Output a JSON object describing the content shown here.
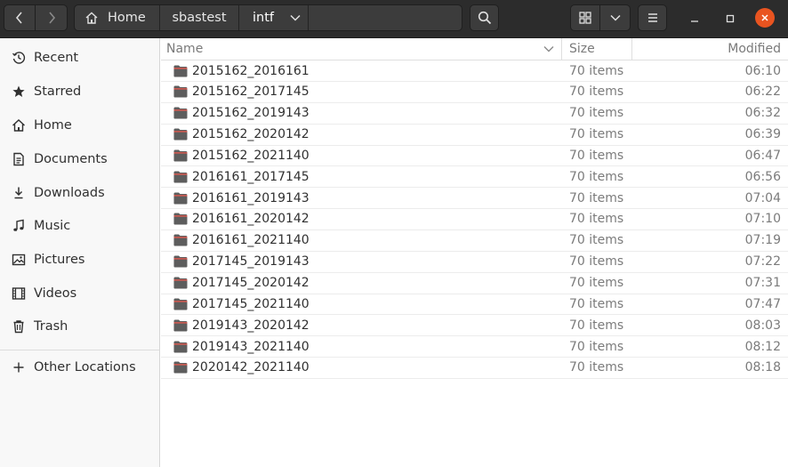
{
  "headerbar": {
    "path": [
      "Home",
      "sbastest",
      "intf"
    ],
    "icons": {
      "back": "chevron-left-icon",
      "forward": "chevron-right-icon",
      "home": "home-icon",
      "path_menu": "chevron-down-icon",
      "search": "search-icon",
      "view": "grid-view-icon",
      "view_menu": "chevron-down-icon",
      "main_menu": "hamburger-menu-icon",
      "minimize": "minimize-icon",
      "maximize": "maximize-icon",
      "close": "close-icon"
    }
  },
  "sidebar": {
    "items": [
      {
        "label": "Recent",
        "icon": "clock-icon"
      },
      {
        "label": "Starred",
        "icon": "star-icon"
      },
      {
        "label": "Home",
        "icon": "home-icon"
      },
      {
        "label": "Documents",
        "icon": "document-icon"
      },
      {
        "label": "Downloads",
        "icon": "download-icon"
      },
      {
        "label": "Music",
        "icon": "music-icon"
      },
      {
        "label": "Pictures",
        "icon": "picture-icon"
      },
      {
        "label": "Videos",
        "icon": "video-icon"
      },
      {
        "label": "Trash",
        "icon": "trash-icon"
      }
    ],
    "other_locations": {
      "label": "Other Locations",
      "icon": "plus-icon"
    }
  },
  "filelist": {
    "columns": {
      "name": "Name",
      "size": "Size",
      "modified": "Modified"
    },
    "rows": [
      {
        "name": "2015162_2016161",
        "size": "70 items",
        "modified": "06:10"
      },
      {
        "name": "2015162_2017145",
        "size": "70 items",
        "modified": "06:22"
      },
      {
        "name": "2015162_2019143",
        "size": "70 items",
        "modified": "06:32"
      },
      {
        "name": "2015162_2020142",
        "size": "70 items",
        "modified": "06:39"
      },
      {
        "name": "2015162_2021140",
        "size": "70 items",
        "modified": "06:47"
      },
      {
        "name": "2016161_2017145",
        "size": "70 items",
        "modified": "06:56"
      },
      {
        "name": "2016161_2019143",
        "size": "70 items",
        "modified": "07:04"
      },
      {
        "name": "2016161_2020142",
        "size": "70 items",
        "modified": "07:10"
      },
      {
        "name": "2016161_2021140",
        "size": "70 items",
        "modified": "07:19"
      },
      {
        "name": "2017145_2019143",
        "size": "70 items",
        "modified": "07:22"
      },
      {
        "name": "2017145_2020142",
        "size": "70 items",
        "modified": "07:31"
      },
      {
        "name": "2017145_2021140",
        "size": "70 items",
        "modified": "07:47"
      },
      {
        "name": "2019143_2020142",
        "size": "70 items",
        "modified": "08:03"
      },
      {
        "name": "2019143_2021140",
        "size": "70 items",
        "modified": "08:12"
      },
      {
        "name": "2020142_2021140",
        "size": "70 items",
        "modified": "08:18"
      }
    ]
  },
  "colors": {
    "headerbar_bg": "#2c2c2c",
    "close_button": "#e95420",
    "folder": "#5d5d5d",
    "folder_accent": "#e05a4f"
  }
}
